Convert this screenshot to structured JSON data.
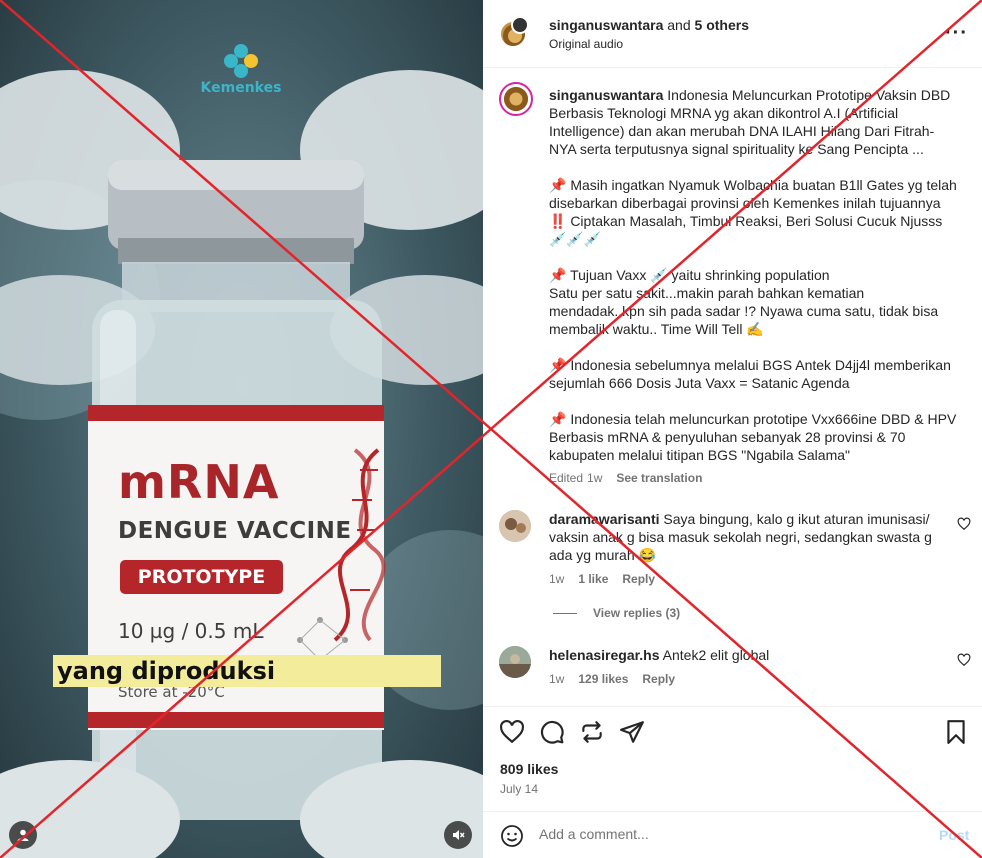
{
  "media": {
    "brand": "Kemenkes",
    "vial_title": "mRNA",
    "vial_name": "DENGUE VACCINE",
    "vial_tag": "PROTOTYPE",
    "vial_dose": "10 µg / 0.5 mL",
    "vial_storage": "Store at -20°C",
    "subtitle": "yang diproduksi",
    "audio_state": "muted",
    "icons": [
      "user-tag-icon",
      "mute-icon"
    ]
  },
  "header": {
    "username": "singanuswantara",
    "and_text": "and",
    "others": "5 others",
    "audio": "Original audio",
    "more": "···"
  },
  "caption": {
    "username": "singanuswantara",
    "paragraphs": [
      "Indonesia Meluncurkan Prototipe Vaksin DBD Berbasis Teknologi MRNA yg akan dikontrol A.I (Artificial Intelligence) dan akan merubah DNA ILAHI Hilang Dari Fitrah-NYA serta terputusnya signal spirituality ke Sang Pencipta ...",
      "📌 Masih ingatkan Nyamuk Wolbachia buatan B1ll Gates yg telah disebarkan diberbagai provinsi oleh Kemenkes inilah tujuannya ‼️ Ciptakan Masalah, Timbul Reaksi, Beri Solusi Cucuk Njusss 💉💉💉",
      "📌 Tujuan Vaxx 💉 yaitu shrinking population\nSatu per satu sakit...makin parah bahkan kematian mendadak..kpn sih pada sadar !? Nyawa cuma satu, tidak bisa membalik waktu.. Time Will Tell ✍️",
      "📌 Indonesia sebelumnya melalui BGS Antek D4jj4l memberikan sejumlah 666 Dosis Juta Vaxx = Satanic Agenda",
      "📌 Indonesia telah meluncurkan prototipe Vxx666ine DBD & HPV Berbasis mRNA & penyuluhan sebanyak 28 provinsi & 70 kabupaten melalui titipan BGS \"Ngabila Salama\""
    ],
    "edited": "Edited",
    "time": "1w",
    "see_translation": "See translation"
  },
  "comments": [
    {
      "username": "daramawarisanti",
      "text": "Saya bingung, kalo g ikut aturan imunisasi/ vaksin anak g bisa masuk sekolah negri, sedangkan swasta g ada yg murah 😂",
      "time": "1w",
      "likes": "1 like",
      "reply": "Reply",
      "view_replies": "View replies (3)"
    },
    {
      "username": "helenasiregar.hs",
      "text": "Antek2 elit global",
      "time": "1w",
      "likes": "129 likes",
      "reply": "Reply"
    }
  ],
  "footer": {
    "likes": "809 likes",
    "date": "July 14",
    "comment_placeholder": "Add a comment...",
    "post": "Post"
  },
  "colors": {
    "overlay_x": "#e4242b",
    "accent_disabled": "#b3dbff",
    "muted_text": "#737373"
  }
}
